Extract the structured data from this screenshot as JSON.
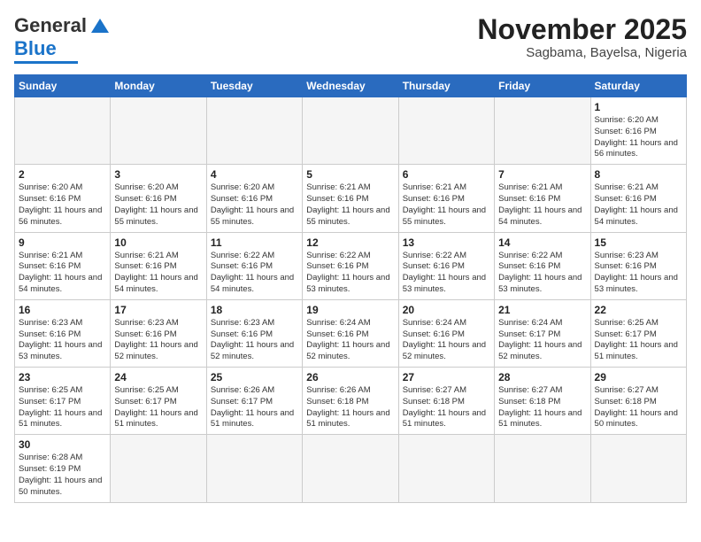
{
  "header": {
    "logo_general": "General",
    "logo_blue": "Blue",
    "month_title": "November 2025",
    "location": "Sagbama, Bayelsa, Nigeria"
  },
  "days_of_week": [
    "Sunday",
    "Monday",
    "Tuesday",
    "Wednesday",
    "Thursday",
    "Friday",
    "Saturday"
  ],
  "weeks": [
    [
      {
        "day": "",
        "empty": true
      },
      {
        "day": "",
        "empty": true
      },
      {
        "day": "",
        "empty": true
      },
      {
        "day": "",
        "empty": true
      },
      {
        "day": "",
        "empty": true
      },
      {
        "day": "",
        "empty": true
      },
      {
        "day": "1",
        "sunrise": "6:20 AM",
        "sunset": "6:16 PM",
        "daylight": "11 hours and 56 minutes."
      }
    ],
    [
      {
        "day": "2",
        "sunrise": "6:20 AM",
        "sunset": "6:16 PM",
        "daylight": "11 hours and 56 minutes."
      },
      {
        "day": "3",
        "sunrise": "6:20 AM",
        "sunset": "6:16 PM",
        "daylight": "11 hours and 55 minutes."
      },
      {
        "day": "4",
        "sunrise": "6:20 AM",
        "sunset": "6:16 PM",
        "daylight": "11 hours and 55 minutes."
      },
      {
        "day": "5",
        "sunrise": "6:21 AM",
        "sunset": "6:16 PM",
        "daylight": "11 hours and 55 minutes."
      },
      {
        "day": "6",
        "sunrise": "6:21 AM",
        "sunset": "6:16 PM",
        "daylight": "11 hours and 55 minutes."
      },
      {
        "day": "7",
        "sunrise": "6:21 AM",
        "sunset": "6:16 PM",
        "daylight": "11 hours and 54 minutes."
      },
      {
        "day": "8",
        "sunrise": "6:21 AM",
        "sunset": "6:16 PM",
        "daylight": "11 hours and 54 minutes."
      }
    ],
    [
      {
        "day": "9",
        "sunrise": "6:21 AM",
        "sunset": "6:16 PM",
        "daylight": "11 hours and 54 minutes."
      },
      {
        "day": "10",
        "sunrise": "6:21 AM",
        "sunset": "6:16 PM",
        "daylight": "11 hours and 54 minutes."
      },
      {
        "day": "11",
        "sunrise": "6:22 AM",
        "sunset": "6:16 PM",
        "daylight": "11 hours and 54 minutes."
      },
      {
        "day": "12",
        "sunrise": "6:22 AM",
        "sunset": "6:16 PM",
        "daylight": "11 hours and 53 minutes."
      },
      {
        "day": "13",
        "sunrise": "6:22 AM",
        "sunset": "6:16 PM",
        "daylight": "11 hours and 53 minutes."
      },
      {
        "day": "14",
        "sunrise": "6:22 AM",
        "sunset": "6:16 PM",
        "daylight": "11 hours and 53 minutes."
      },
      {
        "day": "15",
        "sunrise": "6:23 AM",
        "sunset": "6:16 PM",
        "daylight": "11 hours and 53 minutes."
      }
    ],
    [
      {
        "day": "16",
        "sunrise": "6:23 AM",
        "sunset": "6:16 PM",
        "daylight": "11 hours and 53 minutes."
      },
      {
        "day": "17",
        "sunrise": "6:23 AM",
        "sunset": "6:16 PM",
        "daylight": "11 hours and 52 minutes."
      },
      {
        "day": "18",
        "sunrise": "6:23 AM",
        "sunset": "6:16 PM",
        "daylight": "11 hours and 52 minutes."
      },
      {
        "day": "19",
        "sunrise": "6:24 AM",
        "sunset": "6:16 PM",
        "daylight": "11 hours and 52 minutes."
      },
      {
        "day": "20",
        "sunrise": "6:24 AM",
        "sunset": "6:16 PM",
        "daylight": "11 hours and 52 minutes."
      },
      {
        "day": "21",
        "sunrise": "6:24 AM",
        "sunset": "6:17 PM",
        "daylight": "11 hours and 52 minutes."
      },
      {
        "day": "22",
        "sunrise": "6:25 AM",
        "sunset": "6:17 PM",
        "daylight": "11 hours and 51 minutes."
      }
    ],
    [
      {
        "day": "23",
        "sunrise": "6:25 AM",
        "sunset": "6:17 PM",
        "daylight": "11 hours and 51 minutes."
      },
      {
        "day": "24",
        "sunrise": "6:25 AM",
        "sunset": "6:17 PM",
        "daylight": "11 hours and 51 minutes."
      },
      {
        "day": "25",
        "sunrise": "6:26 AM",
        "sunset": "6:17 PM",
        "daylight": "11 hours and 51 minutes."
      },
      {
        "day": "26",
        "sunrise": "6:26 AM",
        "sunset": "6:18 PM",
        "daylight": "11 hours and 51 minutes."
      },
      {
        "day": "27",
        "sunrise": "6:27 AM",
        "sunset": "6:18 PM",
        "daylight": "11 hours and 51 minutes."
      },
      {
        "day": "28",
        "sunrise": "6:27 AM",
        "sunset": "6:18 PM",
        "daylight": "11 hours and 51 minutes."
      },
      {
        "day": "29",
        "sunrise": "6:27 AM",
        "sunset": "6:18 PM",
        "daylight": "11 hours and 50 minutes."
      }
    ],
    [
      {
        "day": "30",
        "sunrise": "6:28 AM",
        "sunset": "6:19 PM",
        "daylight": "11 hours and 50 minutes."
      },
      {
        "day": "",
        "empty": true
      },
      {
        "day": "",
        "empty": true
      },
      {
        "day": "",
        "empty": true
      },
      {
        "day": "",
        "empty": true
      },
      {
        "day": "",
        "empty": true
      },
      {
        "day": "",
        "empty": true
      }
    ]
  ]
}
